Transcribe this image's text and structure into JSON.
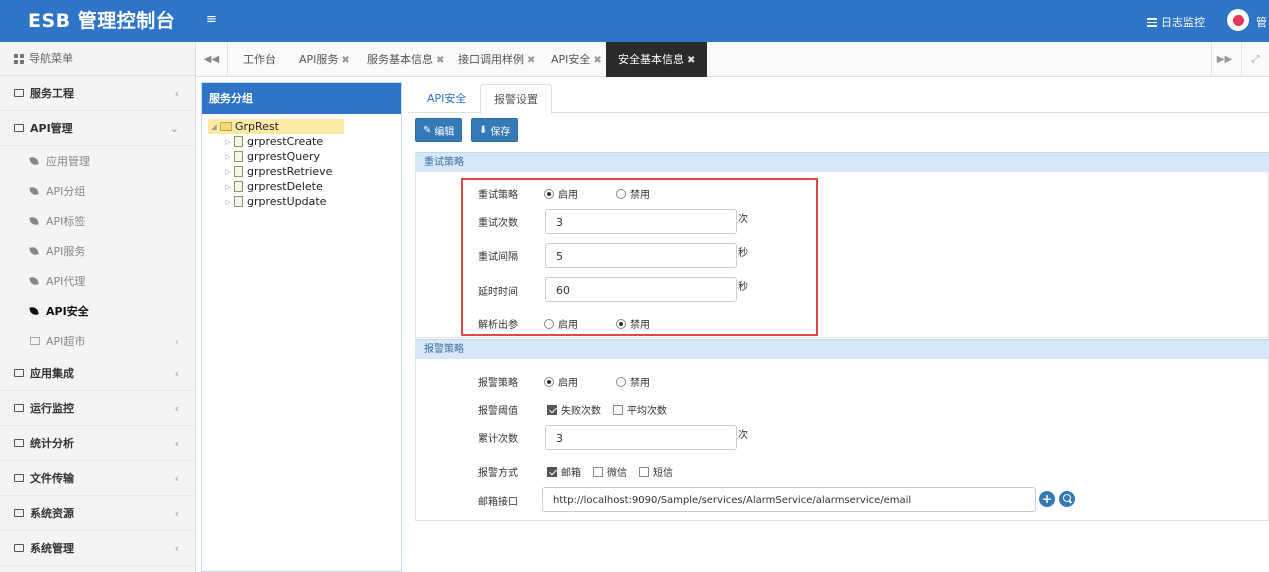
{
  "header": {
    "title": "ESB 管理控制台",
    "menu_toggle": "≡",
    "log_monitor": "日志监控",
    "user": "管"
  },
  "sidebar": {
    "nav_title": "导航菜单",
    "items": [
      {
        "label": "服务工程"
      },
      {
        "label": "API管理"
      },
      {
        "label": "应用集成"
      },
      {
        "label": "运行监控"
      },
      {
        "label": "统计分析"
      },
      {
        "label": "文件传输"
      },
      {
        "label": "系统资源"
      },
      {
        "label": "系统管理"
      }
    ],
    "api_sub": [
      {
        "label": "应用管理"
      },
      {
        "label": "API分组"
      },
      {
        "label": "API标签"
      },
      {
        "label": "API服务"
      },
      {
        "label": "API代理"
      },
      {
        "label": "API安全"
      },
      {
        "label": "API超市"
      }
    ]
  },
  "tabs": [
    {
      "label": "工作台"
    },
    {
      "label": "API服务"
    },
    {
      "label": "服务基本信息"
    },
    {
      "label": "接口调用样例"
    },
    {
      "label": "API安全"
    },
    {
      "label": "安全基本信息"
    }
  ],
  "tree": {
    "title": "服务分组",
    "root": "GrpRest",
    "children": [
      "grprestCreate",
      "grprestQuery",
      "grprestRetrieve",
      "grprestDelete",
      "grprestUpdate"
    ]
  },
  "subtabs": [
    "API安全",
    "报警设置"
  ],
  "toolbar": {
    "edit": "编辑",
    "save": "保存"
  },
  "retry": {
    "section_title": "重试策略",
    "strategy_label": "重试策略",
    "enable": "启用",
    "disable": "禁用",
    "count_label": "重试次数",
    "count_value": "3",
    "count_unit": "次",
    "interval_label": "重试间隔",
    "interval_value": "5",
    "interval_unit": "秒",
    "timeout_label": "延时时间",
    "timeout_value": "60",
    "timeout_unit": "秒",
    "parse_label": "解析出参",
    "parse_enable": "启用",
    "parse_disable": "禁用"
  },
  "alarm": {
    "section_title": "报警策略",
    "strategy_label": "报警策略",
    "enable": "启用",
    "disable": "禁用",
    "threshold_label": "报警阈值",
    "threshold_fail": "失败次数",
    "threshold_avg": "平均次数",
    "cumulative_label": "累计次数",
    "cumulative_value": "3",
    "cumulative_unit": "次",
    "method_label": "报警方式",
    "method_mail": "邮箱",
    "method_wechat": "微信",
    "method_sms": "短信",
    "mail_label": "邮箱接口",
    "mail_value": "http://localhost:9090/Sample/services/AlarmService/alarmservice/email"
  }
}
